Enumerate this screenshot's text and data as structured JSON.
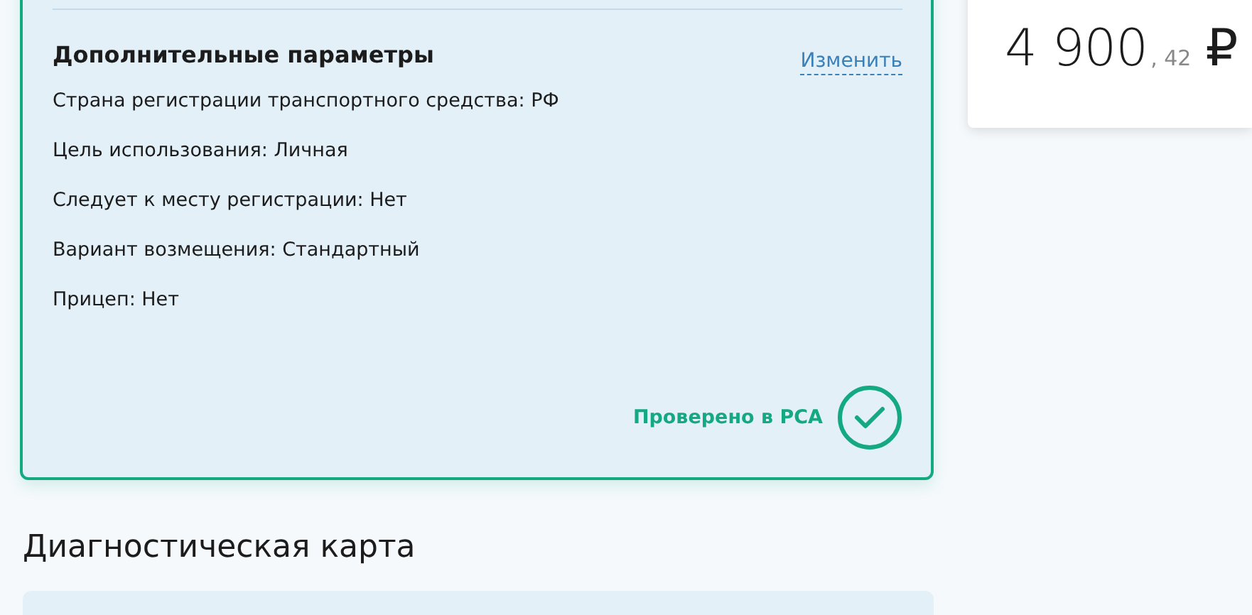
{
  "params_card": {
    "title": "Дополнительные параметры",
    "edit_link": "Изменить",
    "rows": [
      "Страна регистрации транспортного средства: РФ",
      "Цель использования: Личная",
      "Следует к месту регистрации: Нет",
      "Вариант возмещения: Стандартный",
      "Прицеп: Нет"
    ],
    "verified": true,
    "verified_label": "Проверено в РСА"
  },
  "price": {
    "whole": "4 900",
    "fraction": ", 42",
    "currency": "₽"
  },
  "section_title": "Диагностическая карта"
}
